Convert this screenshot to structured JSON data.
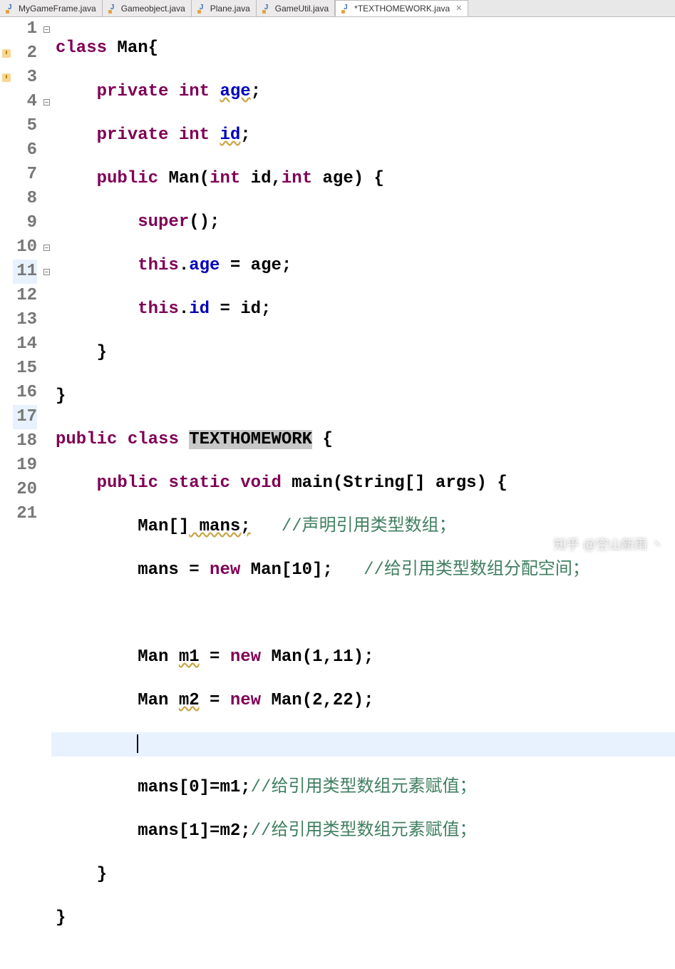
{
  "tabs": [
    {
      "label": "MyGameFrame.java"
    },
    {
      "label": "Gameobject.java"
    },
    {
      "label": "Plane.java"
    },
    {
      "label": "GameUtil.java"
    },
    {
      "label": "*TEXTHOMEWORK.java"
    }
  ],
  "close_glyph": "✕",
  "line_numbers": [
    "1",
    "2",
    "3",
    "4",
    "5",
    "6",
    "7",
    "8",
    "9",
    "10",
    "11",
    "12",
    "13",
    "14",
    "15",
    "16",
    "17",
    "18",
    "19",
    "20",
    "21"
  ],
  "code": {
    "l1": {
      "kw1": "class",
      "cls": "Man",
      "brace": "{"
    },
    "l2": {
      "kw1": "private",
      "kw2": "int",
      "fld": "age",
      "semi": ";"
    },
    "l3": {
      "kw1": "private",
      "kw2": "int",
      "fld": "id",
      "semi": ";"
    },
    "l4": {
      "kw1": "public",
      "name": "Man",
      "lp": "(",
      "kw2": "int",
      "p1": " id,",
      "kw3": "int",
      "p2": " age) {"
    },
    "l5": {
      "kw1": "super",
      "rest": "();"
    },
    "l6": {
      "kw1": "this",
      "dot": ".",
      "fld": "age",
      "rest": " = age;"
    },
    "l7": {
      "kw1": "this",
      "dot": ".",
      "fld": "id",
      "rest": " = id;"
    },
    "l8": {
      "brace": "}"
    },
    "l9": {
      "brace": "}"
    },
    "l10": {
      "kw1": "public",
      "kw2": "class",
      "cls": "TEXTHOMEWORK",
      "brace": " {"
    },
    "l11": {
      "kw1": "public",
      "kw2": "static",
      "kw3": "void",
      "name": "main",
      "sig": "(String[] args) {"
    },
    "l12": {
      "type": "Man[]",
      "var": " mans;",
      "cm": "   //声明引用类型数组；"
    },
    "l13": {
      "a": "mans = ",
      "kw": "new",
      "b": " Man[10];",
      "cm": "   //给引用类型数组分配空间；"
    },
    "l14": {
      "blank": " "
    },
    "l15": {
      "a": "Man ",
      "var": "m1",
      "b": " = ",
      "kw": "new",
      "c": " Man(1,11);"
    },
    "l16": {
      "a": "Man ",
      "var": "m2",
      "b": " = ",
      "kw": "new",
      "c": " Man(2,22);"
    },
    "l17": {
      "blank": " "
    },
    "l18": {
      "a": "mans[0]=m1;",
      "cm": "//给引用类型数组元素赋值；"
    },
    "l19": {
      "a": "mans[1]=m2;",
      "cm": "//给引用类型数组元素赋值；"
    },
    "l20": {
      "brace": "}"
    },
    "l21": {
      "brace": "}"
    }
  },
  "watermark": "知乎 @空山新雨 丶"
}
